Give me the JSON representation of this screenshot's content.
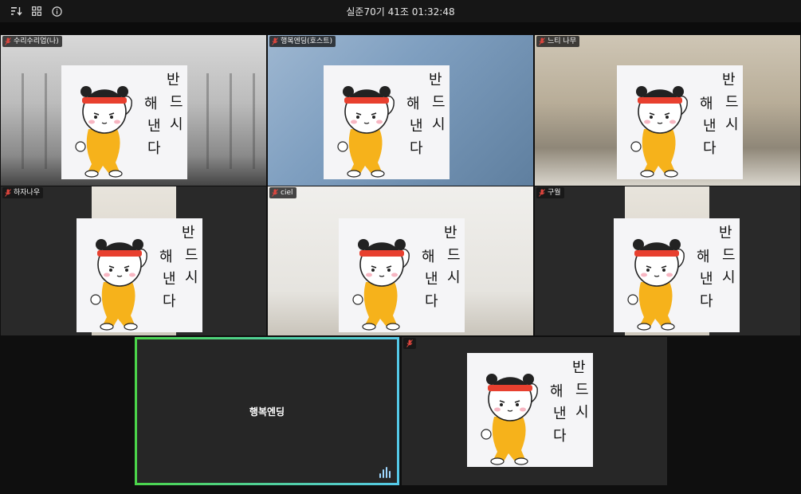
{
  "meeting": {
    "title": "실준70기 41조 01:32:48"
  },
  "toolbar": {
    "icons": [
      "sort-icon",
      "grid-view-icon",
      "info-icon"
    ]
  },
  "participants": [
    {
      "name": "수리수리업(나)",
      "muted": true
    },
    {
      "name": "행복엔딩(호스트)",
      "muted": true
    },
    {
      "name": "느티 나무",
      "muted": true
    },
    {
      "name": "하자나우",
      "muted": true
    },
    {
      "name": "ciel",
      "muted": true
    },
    {
      "name": "구월",
      "muted": true
    }
  ],
  "active_speaker": {
    "name": "행복엔딩"
  },
  "sticker": {
    "text_lines": [
      "반드시",
      "해낸다"
    ]
  },
  "colors": {
    "background": "#0f0f0f",
    "tile": "#272727",
    "speaker_border_start": "#4bd54a",
    "speaker_border_end": "#55c9e8",
    "mic_muted": "#e0463e"
  }
}
